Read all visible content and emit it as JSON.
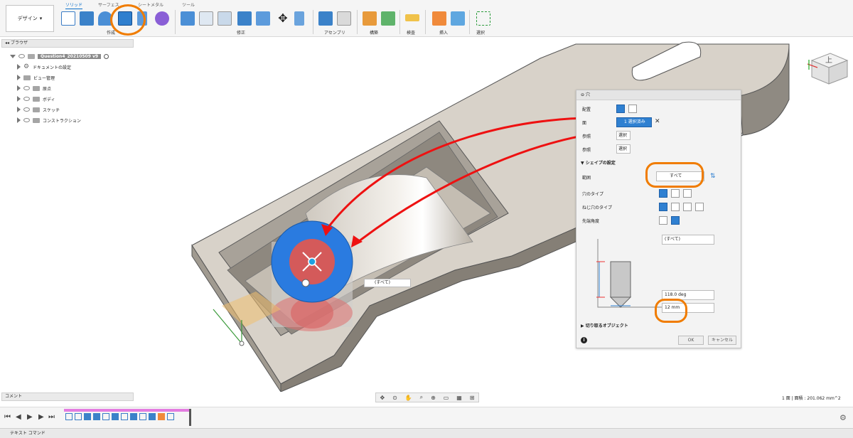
{
  "toolbar": {
    "design_button": "デザイン",
    "tabs": [
      "ソリッド",
      "サーフェス",
      "シートメタル",
      "ツール"
    ],
    "groups": [
      "作成",
      "修正",
      "アセンブリ",
      "構築",
      "検査",
      "挿入",
      "選択"
    ]
  },
  "browser": {
    "title": "ブラウザ",
    "document": "Question4_20210509 v9",
    "items": [
      "ドキュメントの設定",
      "ビュー管理",
      "原点",
      "ボディ",
      "スケッチ",
      "コンストラクション"
    ]
  },
  "comment": "コメント",
  "dialog": {
    "title": "穴",
    "placement_label": "配置",
    "face_label": "面",
    "face_value": "1 選択済み",
    "ref1_label": "参照",
    "ref1_value": "選択",
    "ref2_label": "参照",
    "ref2_value": "選択",
    "shape_section": "シェイプの設定",
    "extent_label": "範囲",
    "extent_value": "すべて",
    "hole_type_label": "穴のタイプ",
    "tap_type_label": "ねじ穴のタイプ",
    "drill_point_label": "先端角度",
    "depth_field": "(すべて)",
    "angle_field": "118.0 deg",
    "diameter_field": "12 mm",
    "objects_section": "切り取るオブジェクト",
    "ok": "OK",
    "cancel": "キャンセル",
    "info_icon": "i"
  },
  "viewport": {
    "inline_field": "(すべて)",
    "viewcube_label": "上"
  },
  "status_right": "1 面 | 面積 : 201.062 mm^2",
  "text_command": "テキスト コマンド",
  "colors": {
    "accent": "#0a6fc9",
    "annotation_red": "#e11",
    "annotation_orange": "#f07c00",
    "body_beige": "#d8d2c9",
    "hole_blue": "#2a7be0"
  }
}
